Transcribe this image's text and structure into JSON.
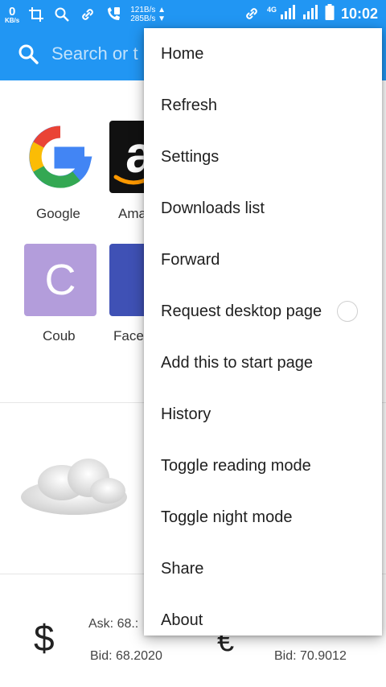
{
  "status_bar": {
    "speed_value": "0",
    "speed_unit": "KB/s",
    "up_speed": "121B/s",
    "down_speed": "285B/s",
    "network_type": "4G",
    "time": "10:02"
  },
  "toolbar": {
    "search_placeholder": "Search or t"
  },
  "speed_dial": [
    {
      "label": "Google"
    },
    {
      "label": "Ama"
    },
    {
      "label": "Coub",
      "letter": "C"
    },
    {
      "label": "Face"
    }
  ],
  "currency": {
    "usd_symbol": "$",
    "usd_ask": "Ask: 68.:",
    "usd_bid": "Bid: 68.2020",
    "eur_symbol": "€",
    "eur_bid": "Bid: 70.9012"
  },
  "menu": {
    "items": [
      {
        "label": "Home"
      },
      {
        "label": "Refresh"
      },
      {
        "label": "Settings"
      },
      {
        "label": "Downloads list"
      },
      {
        "label": "Forward"
      },
      {
        "label": "Request desktop page"
      },
      {
        "label": "Add this to start page"
      },
      {
        "label": "History"
      },
      {
        "label": "Toggle reading mode"
      },
      {
        "label": "Toggle night mode"
      },
      {
        "label": "Share"
      },
      {
        "label": "About"
      }
    ]
  },
  "colors": {
    "accent": "#2196f3",
    "coub_tile": "#b39ddb",
    "facebook_tile": "#3f51b5"
  }
}
